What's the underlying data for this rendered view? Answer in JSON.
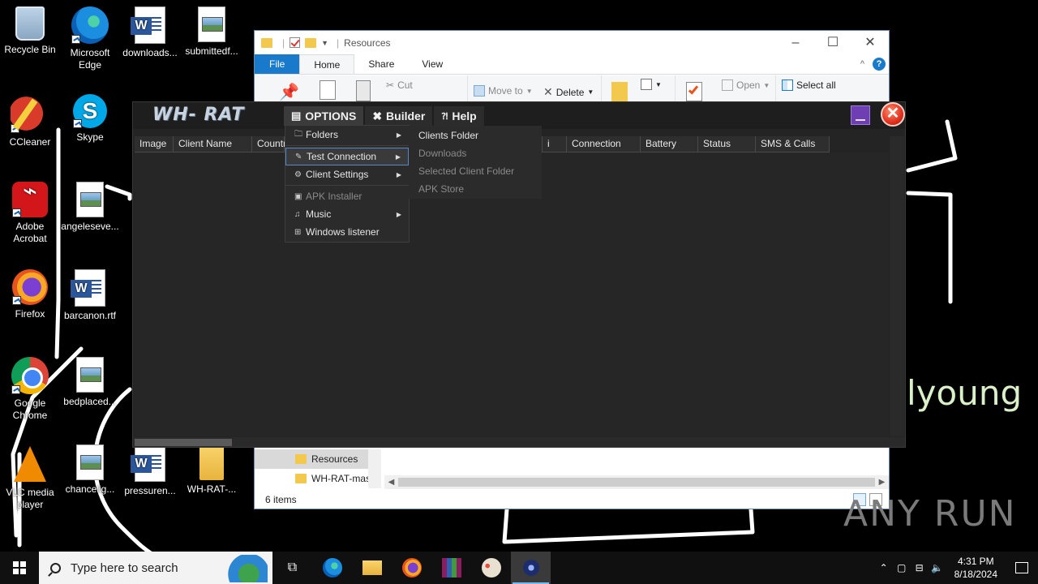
{
  "desktop": {
    "icons": [
      {
        "label": "Recycle Bin",
        "type": "bin"
      },
      {
        "label": "Microsoft Edge",
        "type": "edge"
      },
      {
        "label": "downloads...",
        "type": "word"
      },
      {
        "label": "submittedf...",
        "type": "image"
      },
      {
        "label": "CCleaner",
        "type": "ccleaner"
      },
      {
        "label": "Skype",
        "type": "skype"
      },
      {
        "label": "Adobe Acrobat",
        "type": "acrobat"
      },
      {
        "label": "angeleseve...",
        "type": "image"
      },
      {
        "label": "Firefox",
        "type": "firefox"
      },
      {
        "label": "barcanon.rtf",
        "type": "word"
      },
      {
        "label": "Google Chrome",
        "type": "chrome"
      },
      {
        "label": "bedplaced...",
        "type": "image"
      },
      {
        "label": "VLC media player",
        "type": "vlc"
      },
      {
        "label": "chancelig...",
        "type": "image"
      },
      {
        "label": "pressuren...",
        "type": "word"
      },
      {
        "label": "WH-RAT-...",
        "type": "folder"
      }
    ],
    "wallpaper_text": "lyoung",
    "watermark": "ANY RUN"
  },
  "explorer": {
    "title": "Resources",
    "tabs": [
      "File",
      "Home",
      "Share",
      "View"
    ],
    "ribbon": {
      "cut": "Cut",
      "move_to": "Move to",
      "delete": "Delete",
      "open": "Open",
      "select_all": "Select all"
    },
    "nav_items": [
      "Resources",
      "WH-RAT-mas"
    ],
    "status": "6 items"
  },
  "rat": {
    "logo": "WH- RAT",
    "menu": {
      "options": "OPTIONS",
      "builder": "Builder",
      "help": "Help"
    },
    "columns": [
      {
        "label": "Image"
      },
      {
        "label": "Client Name"
      },
      {
        "label": "Countr"
      },
      {
        "label": ""
      },
      {
        "label": "i"
      },
      {
        "label": "Connection"
      },
      {
        "label": "Battery"
      },
      {
        "label": "Status"
      },
      {
        "label": "SMS & Calls"
      }
    ],
    "options_menu": {
      "folders": "Folders",
      "test_connection": "Test Connection",
      "client_settings": "Client Settings",
      "apk_installer": "APK Installer",
      "music": "Music",
      "windows_listener": "Windows listener"
    },
    "folders_submenu": {
      "clients_folder": "Clients Folder",
      "downloads": "Downloads",
      "selected_client_folder": "Selected Client Folder",
      "apk_store": "APK Store"
    }
  },
  "taskbar": {
    "search_placeholder": "Type here to search",
    "time": "4:31 PM",
    "date": "8/18/2024"
  }
}
